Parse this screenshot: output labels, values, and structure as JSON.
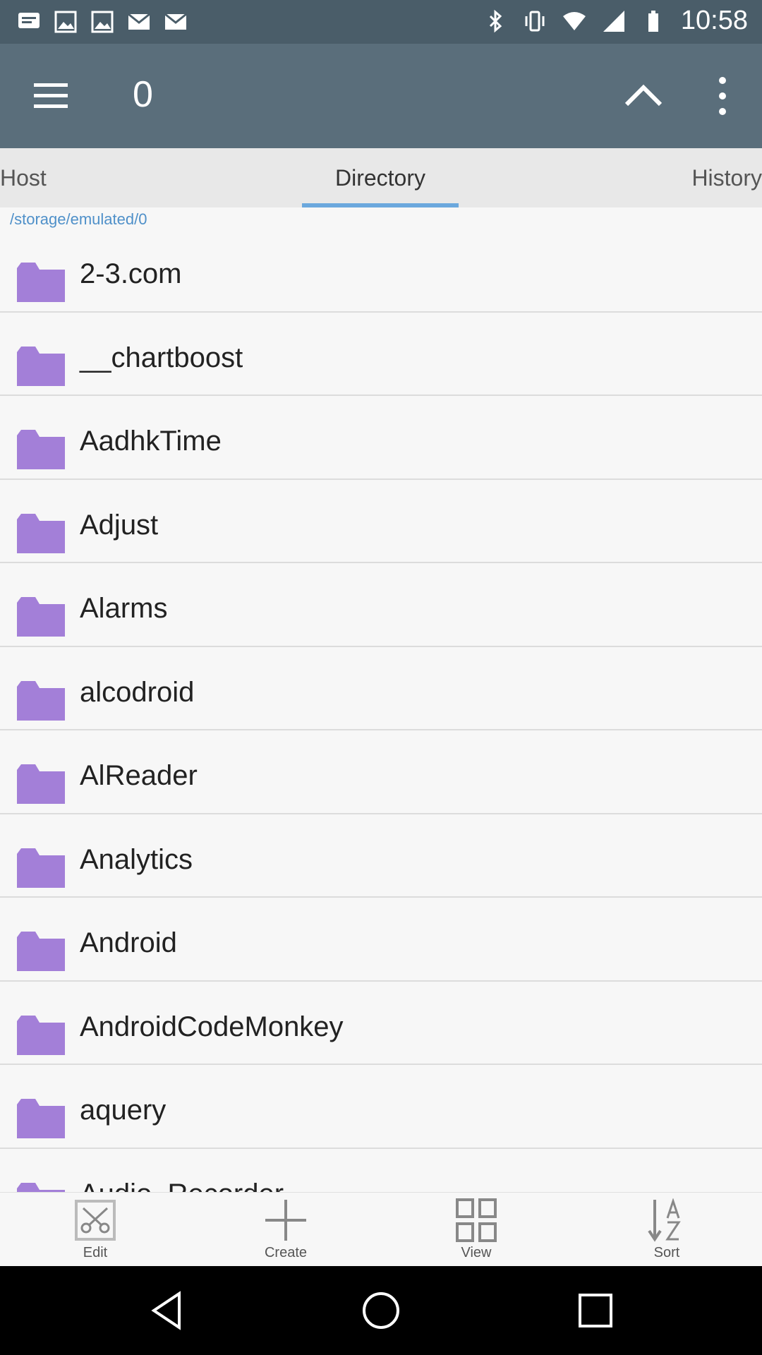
{
  "status_bar": {
    "time": "10:58",
    "notification_icons": [
      "messages-icon",
      "image-icon",
      "image-icon",
      "mail-icon",
      "mail-icon"
    ],
    "system_icons": [
      "bluetooth-icon",
      "vibrate-icon",
      "wifi-icon",
      "signal-icon",
      "battery-icon"
    ]
  },
  "app_bar": {
    "title": "0",
    "menu_icon": "hamburger-menu-icon",
    "up_icon": "chevron-up-icon",
    "more_icon": "more-vertical-icon"
  },
  "tabs": [
    {
      "label": "Host",
      "selected": false
    },
    {
      "label": "Directory",
      "selected": true
    },
    {
      "label": "History",
      "selected": false
    }
  ],
  "path": "/storage/emulated/0",
  "folders": [
    {
      "name": "2-3.com"
    },
    {
      "name": "__chartboost"
    },
    {
      "name": "AadhkTime"
    },
    {
      "name": "Adjust"
    },
    {
      "name": "Alarms"
    },
    {
      "name": "alcodroid"
    },
    {
      "name": "AlReader"
    },
    {
      "name": "Analytics"
    },
    {
      "name": "Android"
    },
    {
      "name": "AndroidCodeMonkey"
    },
    {
      "name": "aquery"
    },
    {
      "name": "Audio_Recorder"
    }
  ],
  "bottom_bar": [
    {
      "label": "Edit",
      "icon": "scissors-icon"
    },
    {
      "label": "Create",
      "icon": "plus-icon"
    },
    {
      "label": "View",
      "icon": "grid-icon"
    },
    {
      "label": "Sort",
      "icon": "sort-az-icon"
    }
  ],
  "colors": {
    "app_bar": "#5a6e7b",
    "status_bar": "#4a5d69",
    "folder": "#a37fd8",
    "tab_indicator": "#6ba8dd",
    "path_text": "#4f90c9"
  }
}
